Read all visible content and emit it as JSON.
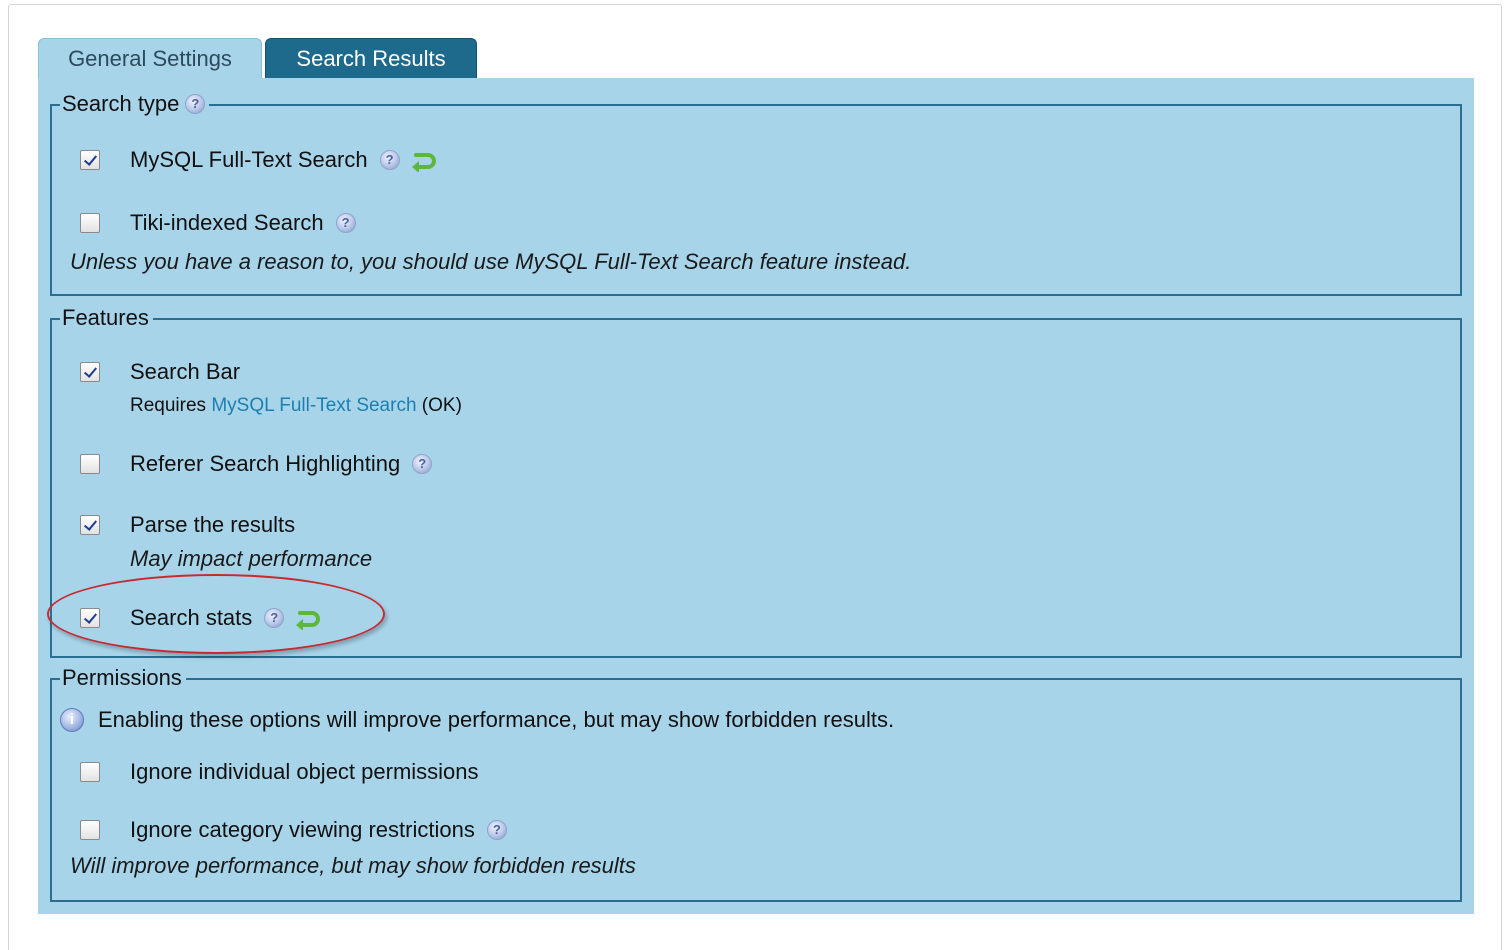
{
  "tabs": [
    {
      "label": "General Settings",
      "active": false
    },
    {
      "label": "Search Results",
      "active": true
    }
  ],
  "search_type": {
    "legend": "Search type",
    "options": [
      {
        "label": "MySQL Full-Text Search",
        "checked": true,
        "help": true,
        "reset": true
      },
      {
        "label": "Tiki-indexed Search",
        "checked": false,
        "help": true,
        "reset": false
      }
    ],
    "note": "Unless you have a reason to, you should use MySQL Full-Text Search feature instead."
  },
  "features": {
    "legend": "Features",
    "options": [
      {
        "label": "Search Bar",
        "checked": true
      },
      {
        "label": "Referer Search Highlighting",
        "checked": false
      },
      {
        "label": "Parse the results",
        "checked": true
      },
      {
        "label": "Search stats",
        "checked": true
      }
    ],
    "search_bar_requires": {
      "prefix": "Requires ",
      "link": "MySQL Full-Text Search",
      "suffix": " (OK)"
    },
    "parse_note": "May impact performance"
  },
  "permissions": {
    "legend": "Permissions",
    "info": "Enabling these options will improve performance, but may show forbidden results.",
    "options": [
      {
        "label": "Ignore individual object permissions",
        "checked": false
      },
      {
        "label": "Ignore category viewing restrictions",
        "checked": false
      }
    ],
    "note": "Will improve performance, but may show forbidden results"
  },
  "icons": {
    "help": "help-icon",
    "reset": "reset-arrow-icon",
    "info": "info-icon"
  },
  "colors": {
    "panel_bg": "#a8d4ea",
    "fieldset_border": "#2a6f92",
    "active_tab": "#1e6a8c",
    "highlight": "#c8282f",
    "link": "#1d7fb0",
    "reset_icon": "#5db83a"
  }
}
